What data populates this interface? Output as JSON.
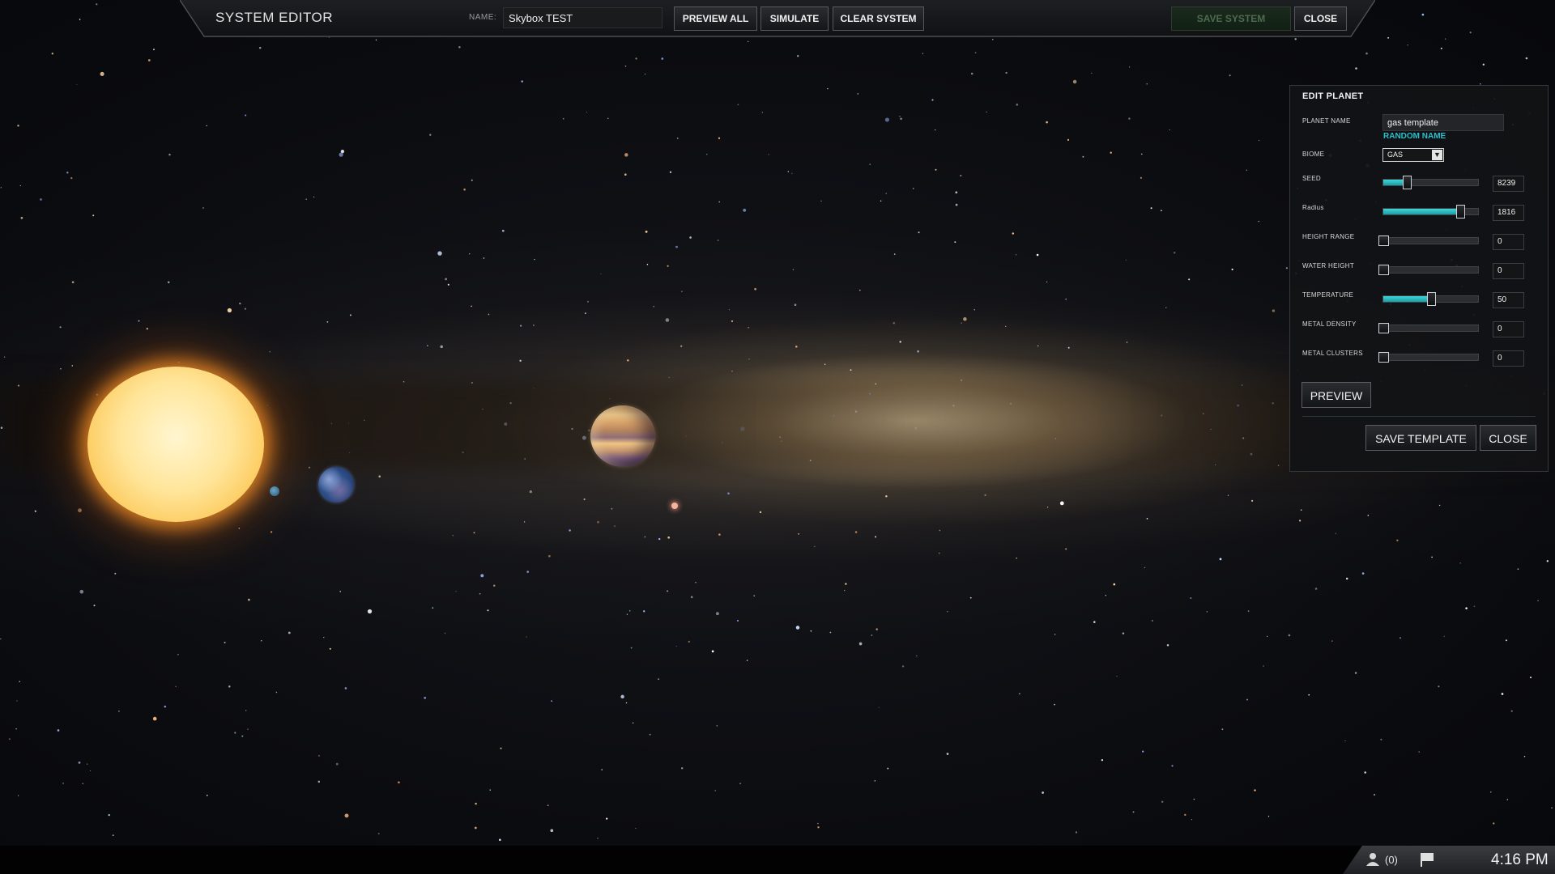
{
  "toolbar": {
    "title": "SYSTEM EDITOR",
    "name_label": "NAME:",
    "name_value": "Skybox TEST",
    "preview_all_label": "PREVIEW ALL",
    "simulate_label": "SIMULATE",
    "clear_system_label": "CLEAR SYSTEM",
    "save_system_label": "SAVE SYSTEM",
    "close_label": "CLOSE"
  },
  "edit_planet": {
    "title": "EDIT PLANET",
    "planet_name_label": "PLANET NAME",
    "planet_name_value": "gas template",
    "random_name_label": "RANDOM NAME",
    "biome_label": "BIOME",
    "biome_value": "GAS",
    "sliders": [
      {
        "key": "seed",
        "label": "SEED",
        "value": "8239",
        "fraction": 0.25
      },
      {
        "key": "radius",
        "label": "Radius",
        "value": "1816",
        "fraction": 0.81
      },
      {
        "key": "height-range",
        "label": "HEIGHT RANGE",
        "value": "0",
        "fraction": 0
      },
      {
        "key": "water-height",
        "label": "WATER HEIGHT",
        "value": "0",
        "fraction": 0
      },
      {
        "key": "temperature",
        "label": "TEMPERATURE",
        "value": "50",
        "fraction": 0.5
      },
      {
        "key": "metal-density",
        "label": "METAL DENSITY",
        "value": "0",
        "fraction": 0
      },
      {
        "key": "metal-clusters",
        "label": "METAL CLUSTERS",
        "value": "0",
        "fraction": 0
      }
    ],
    "preview_label": "PREVIEW",
    "save_template_label": "SAVE TEMPLATE",
    "close_label": "CLOSE"
  },
  "taskbar": {
    "user_count": "(0)",
    "clock": "4:16 PM"
  },
  "colors": {
    "accent": "#28c0cc",
    "slider_fill": "#2bb8c0",
    "save_disabled": "#4e6a50"
  }
}
